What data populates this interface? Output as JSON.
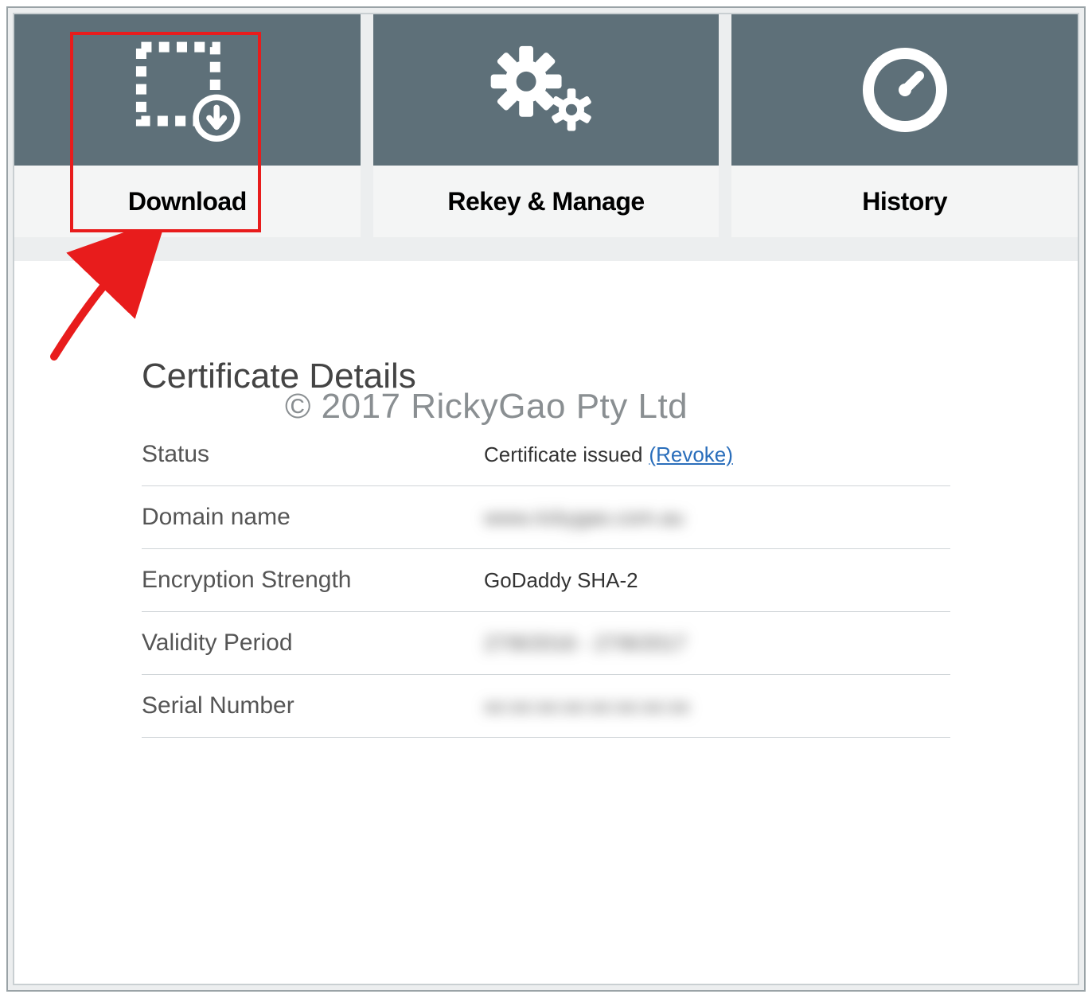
{
  "tabs": {
    "download": {
      "label": "Download"
    },
    "rekey": {
      "label": "Rekey & Manage"
    },
    "history": {
      "label": "History"
    }
  },
  "watermark": "© 2017 RickyGao Pty Ltd",
  "details": {
    "title": "Certificate Details",
    "status": {
      "label": "Status",
      "value": "Certificate issued",
      "revoke_link": "(Revoke)"
    },
    "domain": {
      "label": "Domain name",
      "value": "www.rickygao.com.au"
    },
    "encryption": {
      "label": "Encryption Strength",
      "value": "GoDaddy SHA-2"
    },
    "validity": {
      "label": "Validity Period",
      "value": "27/8/2016 - 27/8/2017"
    },
    "serial": {
      "label": "Serial Number",
      "value": "xx:xx:xx:xx:xx:xx:xx:xx"
    }
  },
  "colors": {
    "tab_bg": "#5e7079",
    "highlight": "#e81c1c",
    "link": "#2a6ebb"
  }
}
